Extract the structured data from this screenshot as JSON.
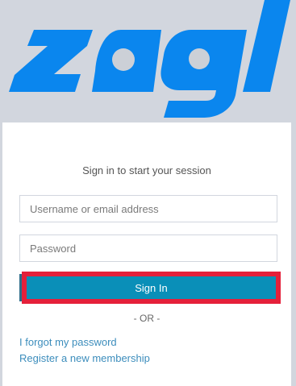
{
  "brand": {
    "logo_text": "zagl",
    "logo_color": "#0a86ee",
    "logo_icon": "zagl-logo-icon"
  },
  "login": {
    "message": "Sign in to start your session",
    "username_placeholder": "Username or email address",
    "password_placeholder": "Password",
    "signin_label": "Sign In",
    "or_text": "- OR -",
    "forgot_label": "I forgot my password",
    "register_label": "Register a new membership"
  },
  "colors": {
    "page_bg": "#d2d6de",
    "button_bg": "#0a8fb8",
    "highlight_border": "#e5203a",
    "link": "#3c8dbc"
  }
}
